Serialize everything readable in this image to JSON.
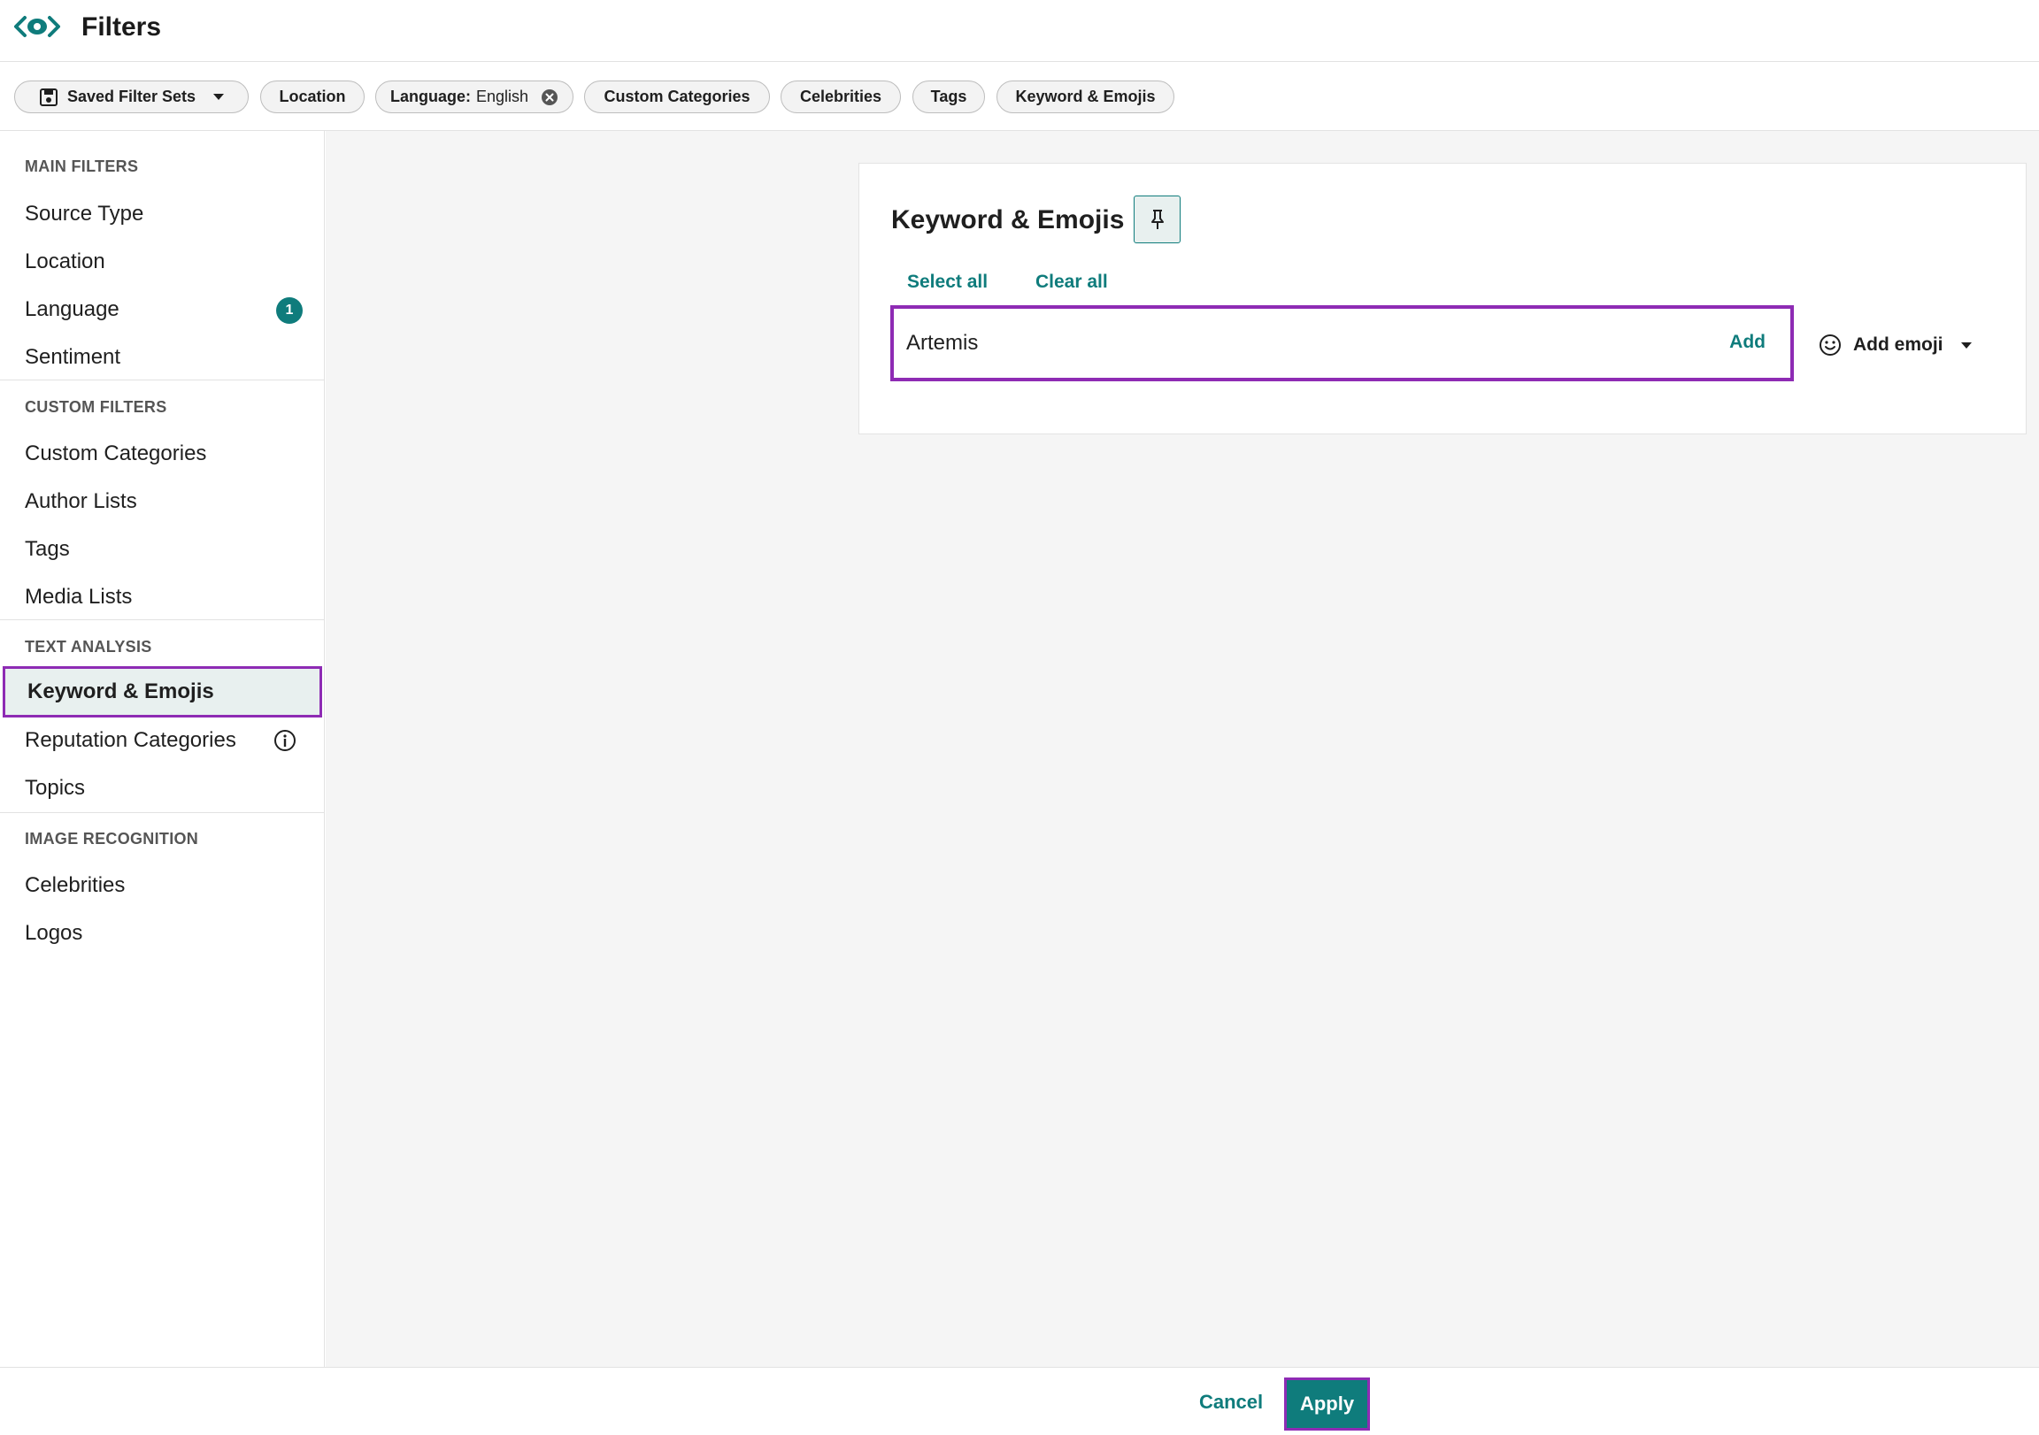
{
  "header": {
    "title": "Filters",
    "logo_icon": "eye-logo-icon"
  },
  "chips": {
    "saved_filter_sets": "Saved Filter Sets",
    "location": "Location",
    "language_label": "Language:",
    "language_value": "English",
    "custom_categories": "Custom Categories",
    "celebrities": "Celebrities",
    "tags": "Tags",
    "keyword_emojis": "Keyword & Emojis"
  },
  "sidebar": {
    "main_filters": {
      "title": "MAIN FILTERS",
      "items": [
        {
          "label": "Source Type"
        },
        {
          "label": "Location"
        },
        {
          "label": "Language",
          "badge": "1"
        },
        {
          "label": "Sentiment"
        }
      ]
    },
    "custom_filters": {
      "title": "CUSTOM FILTERS",
      "items": [
        {
          "label": "Custom Categories"
        },
        {
          "label": "Author Lists"
        },
        {
          "label": "Tags"
        },
        {
          "label": "Media Lists"
        }
      ]
    },
    "text_analysis": {
      "title": "TEXT ANALYSIS",
      "items": [
        {
          "label": "Keyword & Emojis",
          "active": true
        },
        {
          "label": "Reputation Categories",
          "icon": "info-icon"
        },
        {
          "label": "Topics"
        }
      ]
    },
    "image_recognition": {
      "title": "IMAGE RECOGNITION",
      "items": [
        {
          "label": "Celebrities"
        },
        {
          "label": "Logos"
        }
      ]
    }
  },
  "main": {
    "card": {
      "title": "Keyword & Emojis",
      "select_all": "Select all",
      "clear_all": "Clear all",
      "input_value": "Artemis",
      "add_label": "Add",
      "add_emoji_label": "Add emoji"
    }
  },
  "footer": {
    "cancel": "Cancel",
    "apply": "Apply"
  },
  "colors": {
    "accent": "#0f7c7c",
    "highlight": "#8e2bb4",
    "active_bg": "#e8f0ef"
  }
}
